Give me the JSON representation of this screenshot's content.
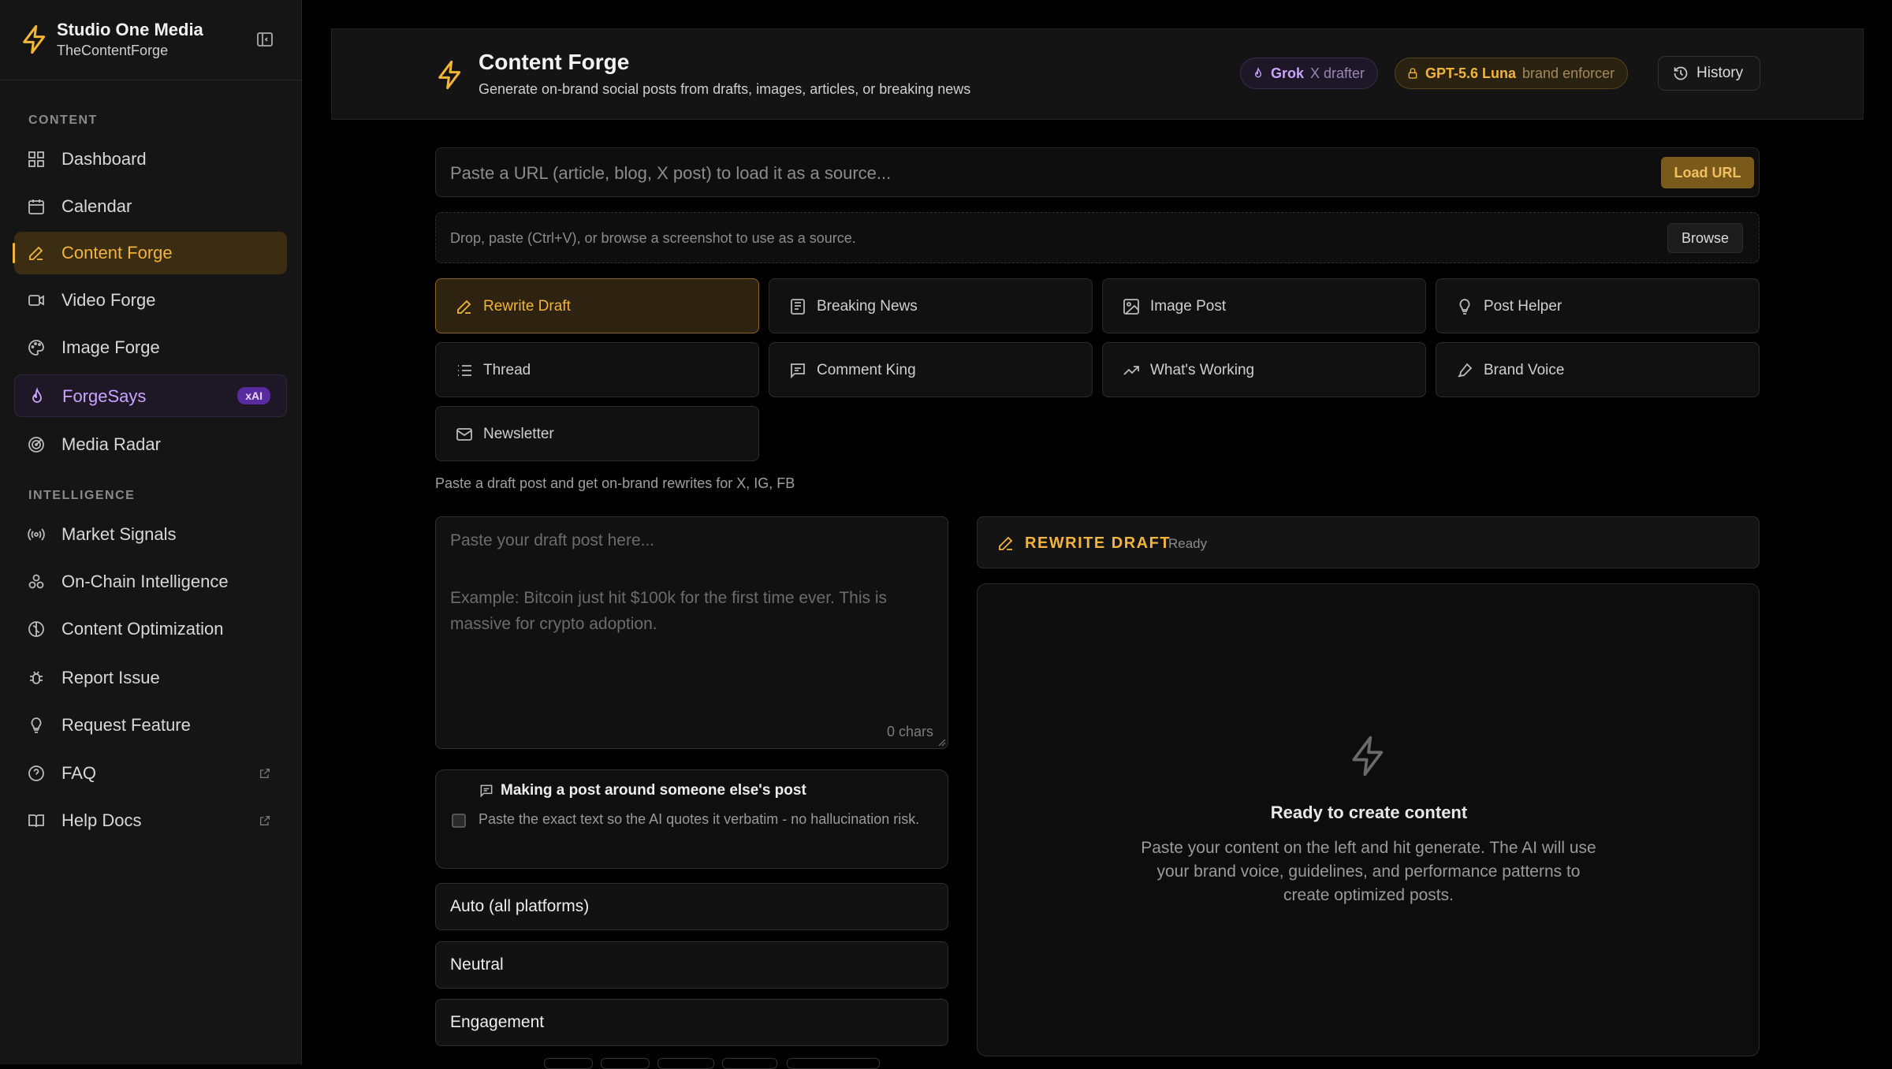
{
  "sidebar": {
    "brand_name": "Studio One Media",
    "brand_sub": "TheContentForge",
    "section_content": "CONTENT",
    "section_intel": "INTELLIGENCE",
    "items": [
      {
        "label": "Dashboard",
        "icon": "dashboard-icon"
      },
      {
        "label": "Calendar",
        "icon": "calendar-icon"
      },
      {
        "label": "Content Forge",
        "icon": "pencil-icon",
        "active": true
      },
      {
        "label": "Video Forge",
        "icon": "video-icon"
      },
      {
        "label": "Image Forge",
        "icon": "palette-icon"
      },
      {
        "label": "ForgeSays",
        "icon": "flame-icon",
        "badge": "xAI"
      },
      {
        "label": "Media Radar",
        "icon": "radar-icon"
      },
      {
        "label": "Market Signals",
        "icon": "radio-icon"
      },
      {
        "label": "On-Chain Intelligence",
        "icon": "network-icon"
      },
      {
        "label": "Content Optimization",
        "icon": "brain-icon"
      },
      {
        "label": "Report Issue",
        "icon": "bug-icon"
      },
      {
        "label": "Request Feature",
        "icon": "lightbulb-icon"
      },
      {
        "label": "FAQ",
        "icon": "question-icon"
      },
      {
        "label": "Help Docs",
        "icon": "book-icon"
      }
    ]
  },
  "header": {
    "title": "Content Forge",
    "subtitle": "Generate on-brand social posts from drafts, images, articles, or breaking news",
    "grok_name": "Grok",
    "grok_role": "X drafter",
    "gpt_name": "GPT-5.6 Luna",
    "gpt_role": "brand enforcer",
    "history": "History"
  },
  "source": {
    "url_placeholder": "Paste a URL (article, blog, X post) to load it as a source...",
    "load_url": "Load URL",
    "drop_text": "Drop, paste (Ctrl+V), or browse a screenshot to use as a source.",
    "browse": "Browse"
  },
  "modes": [
    {
      "label": "Rewrite Draft",
      "icon": "pencil-icon",
      "active": true
    },
    {
      "label": "Breaking News",
      "icon": "newspaper-icon"
    },
    {
      "label": "Image Post",
      "icon": "image-icon"
    },
    {
      "label": "Post Helper",
      "icon": "lightbulb-icon"
    },
    {
      "label": "Thread",
      "icon": "list-icon"
    },
    {
      "label": "Comment King",
      "icon": "comment-icon"
    },
    {
      "label": "What's Working",
      "icon": "trending-icon"
    },
    {
      "label": "Brand Voice",
      "icon": "pen-icon"
    },
    {
      "label": "Newsletter",
      "icon": "mail-icon"
    }
  ],
  "hint": "Paste a draft post and get on-brand rewrites for X, IG, FB",
  "draft": {
    "placeholder": "Paste your draft post here...",
    "example": "Example: Bitcoin just hit $100k for the first time ever. This is massive for crypto adoption.",
    "count": "0 chars"
  },
  "quote": {
    "title": "Making a post around someone else's post",
    "desc": "Paste the exact text so the AI quotes it verbatim - no hallucination risk."
  },
  "selects": {
    "platform": "Auto (all platforms)",
    "tone": "Neutral",
    "goal": "Engagement"
  },
  "output": {
    "mode": "REWRITE DRAFT",
    "status": "Ready",
    "empty_title": "Ready to create content",
    "empty_desc": "Paste your content on the left and hit generate. The AI will use your brand voice, guidelines, and performance patterns to create optimized posts."
  },
  "colors": {
    "accent": "#f3b43a",
    "xai": "#c9a4ff",
    "bg": "#000000",
    "panel": "#151515"
  }
}
